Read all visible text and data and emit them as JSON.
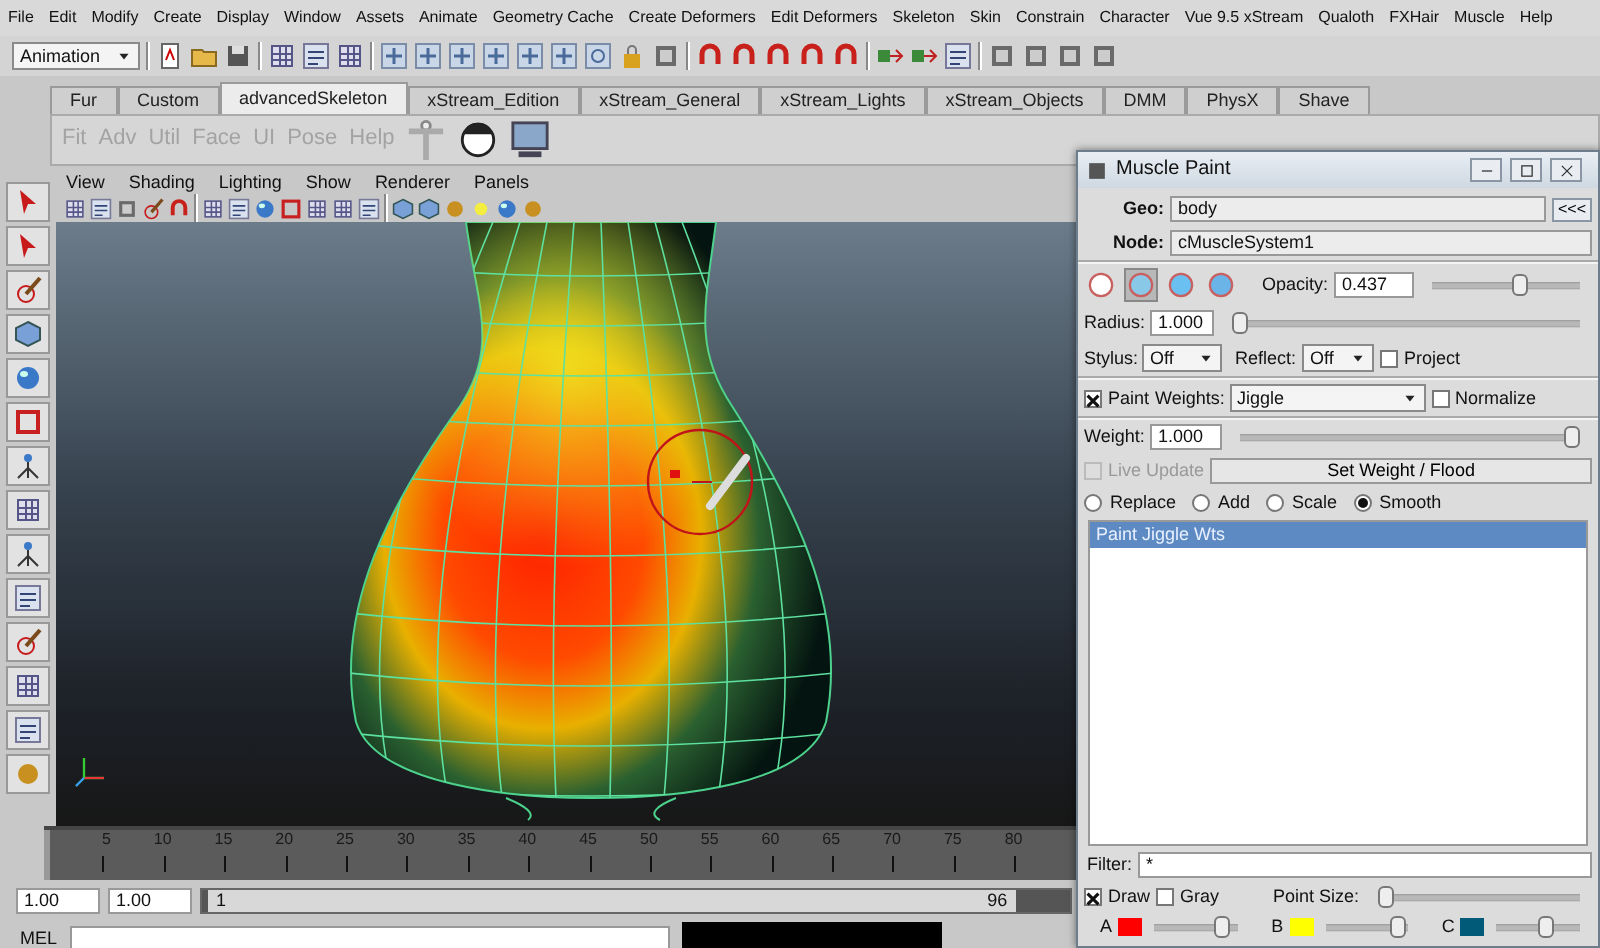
{
  "menu_bar": [
    "File",
    "Edit",
    "Modify",
    "Create",
    "Display",
    "Window",
    "Assets",
    "Animate",
    "Geometry Cache",
    "Create Deformers",
    "Edit Deformers",
    "Skeleton",
    "Skin",
    "Constrain",
    "Character",
    "Vue 9.5 xStream",
    "Qualoth",
    "FXHair",
    "Muscle",
    "Help"
  ],
  "status_line": {
    "mode": "Animation"
  },
  "shelf": {
    "tabs": [
      {
        "label": "Fur",
        "selected": false
      },
      {
        "label": "Custom",
        "selected": false
      },
      {
        "label": "advancedSkeleton",
        "selected": true
      },
      {
        "label": "xStream_Edition",
        "selected": false
      },
      {
        "label": "xStream_General",
        "selected": false
      },
      {
        "label": "xStream_Lights",
        "selected": false
      },
      {
        "label": "xStream_Objects",
        "selected": false
      },
      {
        "label": "DMM",
        "selected": false
      },
      {
        "label": "PhysX",
        "selected": false
      },
      {
        "label": "Shave",
        "selected": false
      }
    ],
    "buttons": [
      "Fit",
      "Adv",
      "Util",
      "Face",
      "UI",
      "Pose",
      "Help"
    ]
  },
  "viewport": {
    "menus": [
      "View",
      "Shading",
      "Lighting",
      "Show",
      "Renderer",
      "Panels"
    ]
  },
  "timeline": {
    "level": 0,
    "frames": [
      "5",
      "10",
      "15",
      "20",
      "25",
      "30",
      "35",
      "40",
      "45",
      "50",
      "55",
      "60",
      "65",
      "70",
      "75",
      "80"
    ]
  },
  "range": {
    "start": "1.00",
    "current": "1.00",
    "range_start": "1",
    "range_end": "96",
    "level": 0.93
  },
  "command_line": {
    "label": "MEL"
  },
  "muscle_paint": {
    "title": "Muscle Paint",
    "geo": {
      "label": "Geo:",
      "value": "body",
      "button": "<<<"
    },
    "node": {
      "label": "Node:",
      "value": "cMuscleSystem1"
    },
    "profiles": [
      {
        "selected": false
      },
      {
        "selected": true
      },
      {
        "selected": false
      },
      {
        "selected": false
      }
    ],
    "opacity": {
      "label": "Opacity:",
      "value": "0.437",
      "level": 0.6
    },
    "radius": {
      "label": "Radius:",
      "value": "1.000",
      "level": 0
    },
    "stylus": {
      "label": "Stylus:",
      "value": "Off"
    },
    "reflect": {
      "label": "Reflect:",
      "value": "Off"
    },
    "project": {
      "label": "Project",
      "checked": false
    },
    "paint": {
      "label": "Paint",
      "checked": true
    },
    "weights": {
      "label": "Weights:",
      "value": "Jiggle"
    },
    "normalize": {
      "label": "Normalize",
      "checked": false
    },
    "weight": {
      "label": "Weight:",
      "value": "1.000",
      "level": 1
    },
    "live_update": {
      "label": "Live Update",
      "checked": false,
      "disabled": true
    },
    "flood_button": "Set Weight / Flood",
    "modes": [
      {
        "label": "Replace",
        "selected": false
      },
      {
        "label": "Add",
        "selected": false
      },
      {
        "label": "Scale",
        "selected": false
      },
      {
        "label": "Smooth",
        "selected": true
      }
    ],
    "list": [
      {
        "label": "Paint Jiggle Wts",
        "selected": true
      }
    ],
    "filter": {
      "label": "Filter:",
      "value": "*"
    },
    "draw": {
      "label": "Draw",
      "checked": true
    },
    "gray": {
      "label": "Gray",
      "checked": false
    },
    "point_size": {
      "label": "Point Size:",
      "level": 0
    },
    "colors": [
      {
        "label": "A",
        "color": "#ff0000",
        "level": 0.88
      },
      {
        "label": "B",
        "color": "#ffff00",
        "level": 0.97
      },
      {
        "label": "C",
        "color": "#005a78",
        "level": 0.6
      }
    ]
  }
}
